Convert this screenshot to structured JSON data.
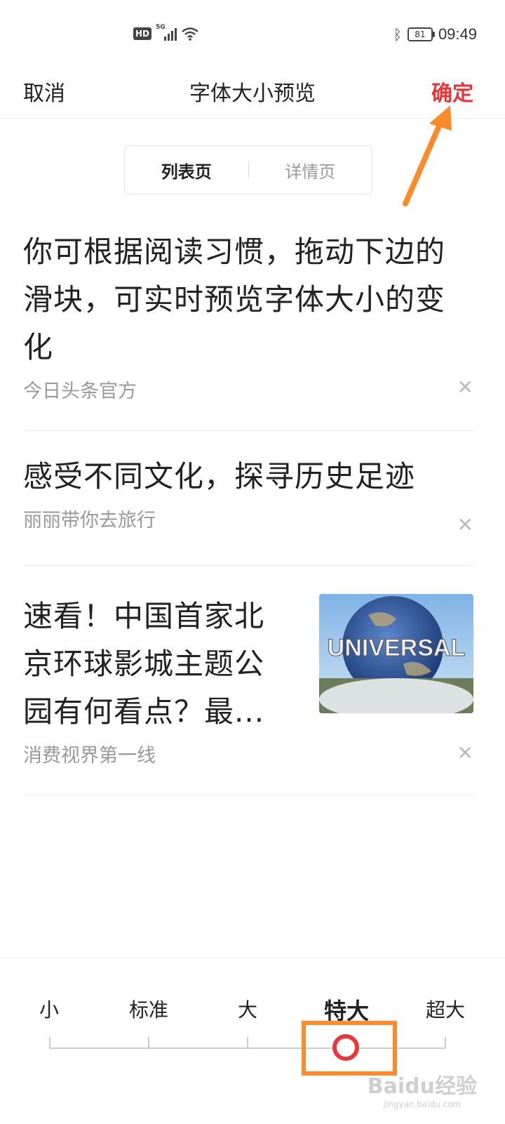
{
  "status_bar": {
    "hd": "HD",
    "network": "5G",
    "battery": "81",
    "time": "09:49"
  },
  "nav": {
    "cancel": "取消",
    "title": "字体大小预览",
    "confirm": "确定",
    "confirm_color": "#e8373b"
  },
  "tabs": [
    "列表页",
    "详情页"
  ],
  "feed": [
    {
      "headline": "你可根据阅读习惯，拖动下边的滑块，可实时预览字体大小的变化",
      "source": "今日头条官方"
    },
    {
      "headline": "感受不同文化，探寻历史足迹",
      "source": "丽丽带你去旅行"
    },
    {
      "headline": "速看！中国首家北京环球影城主题公园有何看点？最...",
      "source": "消费视界第一线",
      "thumbnail_text": "UNIVERSAL"
    }
  ],
  "font_sizes": {
    "options": [
      "小",
      "标准",
      "大",
      "特大",
      "超大"
    ],
    "selected": "特大"
  },
  "watermark": {
    "text": "Baidu经验",
    "sub": "jingyan.baidu.com"
  },
  "annotation_color": "#ff8a2a"
}
